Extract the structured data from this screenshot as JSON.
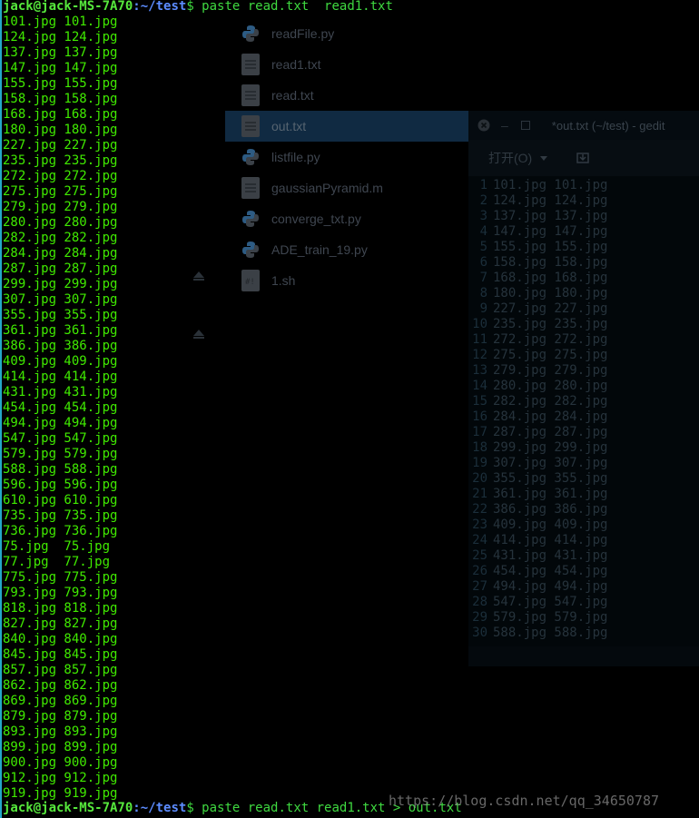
{
  "terminal": {
    "prompt_user": "jack@jack-MS-7A70",
    "prompt_path": ":~/test",
    "prompt_symbol": "$ ",
    "first_command": "paste read.txt  read1.txt",
    "last_command": "paste read.txt read1.txt > out.txt",
    "output_lines": [
      "101.jpg 101.jpg",
      "124.jpg 124.jpg",
      "137.jpg 137.jpg",
      "147.jpg 147.jpg",
      "155.jpg 155.jpg",
      "158.jpg 158.jpg",
      "168.jpg 168.jpg",
      "180.jpg 180.jpg",
      "227.jpg 227.jpg",
      "235.jpg 235.jpg",
      "272.jpg 272.jpg",
      "275.jpg 275.jpg",
      "279.jpg 279.jpg",
      "280.jpg 280.jpg",
      "282.jpg 282.jpg",
      "284.jpg 284.jpg",
      "287.jpg 287.jpg",
      "299.jpg 299.jpg",
      "307.jpg 307.jpg",
      "355.jpg 355.jpg",
      "361.jpg 361.jpg",
      "386.jpg 386.jpg",
      "409.jpg 409.jpg",
      "414.jpg 414.jpg",
      "431.jpg 431.jpg",
      "454.jpg 454.jpg",
      "494.jpg 494.jpg",
      "547.jpg 547.jpg",
      "579.jpg 579.jpg",
      "588.jpg 588.jpg",
      "596.jpg 596.jpg",
      "610.jpg 610.jpg",
      "735.jpg 735.jpg",
      "736.jpg 736.jpg",
      "75.jpg  75.jpg",
      "77.jpg  77.jpg",
      "775.jpg 775.jpg",
      "793.jpg 793.jpg",
      "818.jpg 818.jpg",
      "827.jpg 827.jpg",
      "840.jpg 840.jpg",
      "845.jpg 845.jpg",
      "857.jpg 857.jpg",
      "862.jpg 862.jpg",
      "869.jpg 869.jpg",
      "879.jpg 879.jpg",
      "893.jpg 893.jpg",
      "899.jpg 899.jpg",
      "900.jpg 900.jpg",
      "912.jpg 912.jpg",
      "919.jpg 919.jpg"
    ]
  },
  "file_manager": {
    "files": [
      {
        "name": "readFile.py",
        "icon": "python-file-icon"
      },
      {
        "name": "read1.txt",
        "icon": "text-file-icon"
      },
      {
        "name": "read.txt",
        "icon": "text-file-icon"
      },
      {
        "name": "out.txt",
        "icon": "text-file-icon",
        "selected": true
      },
      {
        "name": "listfile.py",
        "icon": "python-file-icon"
      },
      {
        "name": "gaussianPyramid.m",
        "icon": "text-file-icon"
      },
      {
        "name": "converge_txt.py",
        "icon": "python-file-icon"
      },
      {
        "name": "ADE_train_19.py",
        "icon": "python-file-icon"
      },
      {
        "name": "1.sh",
        "icon": "script-file-icon"
      }
    ]
  },
  "gedit": {
    "title": "*out.txt (~/test) - gedit",
    "minimize_label": "–",
    "open_label": "打开(O)",
    "lines": [
      {
        "n": "1",
        "t": "101.jpg 101.jpg"
      },
      {
        "n": "2",
        "t": "124.jpg 124.jpg"
      },
      {
        "n": "3",
        "t": "137.jpg 137.jpg"
      },
      {
        "n": "4",
        "t": "147.jpg 147.jpg"
      },
      {
        "n": "5",
        "t": "155.jpg 155.jpg"
      },
      {
        "n": "6",
        "t": "158.jpg 158.jpg"
      },
      {
        "n": "7",
        "t": "168.jpg 168.jpg"
      },
      {
        "n": "8",
        "t": "180.jpg 180.jpg"
      },
      {
        "n": "9",
        "t": "227.jpg 227.jpg"
      },
      {
        "n": "10",
        "t": "235.jpg 235.jpg"
      },
      {
        "n": "11",
        "t": "272.jpg 272.jpg"
      },
      {
        "n": "12",
        "t": "275.jpg 275.jpg"
      },
      {
        "n": "13",
        "t": "279.jpg 279.jpg"
      },
      {
        "n": "14",
        "t": "280.jpg 280.jpg"
      },
      {
        "n": "15",
        "t": "282.jpg 282.jpg"
      },
      {
        "n": "16",
        "t": "284.jpg 284.jpg"
      },
      {
        "n": "17",
        "t": "287.jpg 287.jpg"
      },
      {
        "n": "18",
        "t": "299.jpg 299.jpg"
      },
      {
        "n": "19",
        "t": "307.jpg 307.jpg"
      },
      {
        "n": "20",
        "t": "355.jpg 355.jpg"
      },
      {
        "n": "21",
        "t": "361.jpg 361.jpg"
      },
      {
        "n": "22",
        "t": "386.jpg 386.jpg"
      },
      {
        "n": "23",
        "t": "409.jpg 409.jpg"
      },
      {
        "n": "24",
        "t": "414.jpg 414.jpg"
      },
      {
        "n": "25",
        "t": "431.jpg 431.jpg"
      },
      {
        "n": "26",
        "t": "454.jpg 454.jpg"
      },
      {
        "n": "27",
        "t": "494.jpg 494.jpg"
      },
      {
        "n": "28",
        "t": "547.jpg 547.jpg"
      },
      {
        "n": "29",
        "t": "579.jpg 579.jpg"
      },
      {
        "n": "30",
        "t": "588.jpg 588.jpg"
      }
    ]
  },
  "watermark": "https://blog.csdn.net/qq_34650787"
}
